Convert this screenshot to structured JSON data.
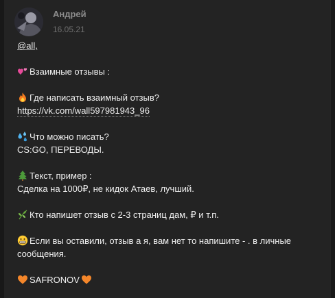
{
  "post": {
    "author": "Андрей",
    "date": "16.05.21",
    "mention": "@all,",
    "title": "Взаимные отзывы :",
    "q1": "Где написать взаимный отзыв?",
    "link": "https://vk.com/wall597981943_96",
    "q2": "Что можно писать?",
    "a2": "CS:GO, ПЕРЕВОДЫ.",
    "q3": "Текст, пример :",
    "a3": "Сделка на 1000₽, не кидок Атаев, лучший.",
    "offer": "Кто напишет отзыв с 2-3 страниц дам, ₽ и т.п.",
    "note": "Если вы оставили, отзыв а я, вам нет то напишите - . в личные сообщения.",
    "signature": "SAFRONOV"
  },
  "icons": {
    "hearts": "two-hearts-icon",
    "fire": "fire-icon",
    "drops": "sweat-droplets-icon",
    "tree": "evergreen-tree-icon",
    "herb": "herb-icon",
    "face": "grimacing-face-icon",
    "heart": "orange-heart-icon"
  }
}
